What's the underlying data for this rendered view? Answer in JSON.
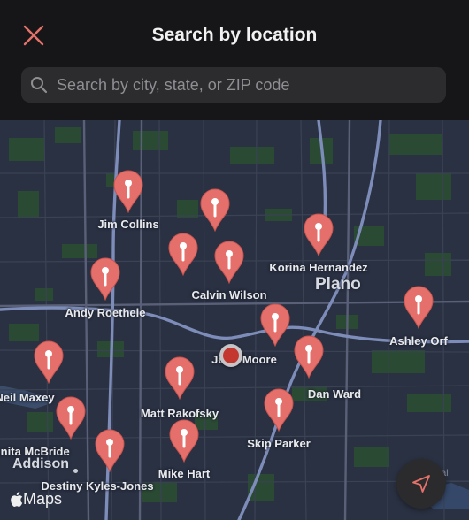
{
  "header": {
    "title": "Search by location",
    "close_icon": "close-icon"
  },
  "search": {
    "placeholder": "Search by city, state, or ZIP code",
    "value": "",
    "icon": "search-icon"
  },
  "map": {
    "cities": {
      "plano": "Plano",
      "addison": "Addison"
    },
    "pins": [
      {
        "id": "jim-collins",
        "label": "Jim Collins"
      },
      {
        "id": "unlabeled-1",
        "label": ""
      },
      {
        "id": "korina-hernandez",
        "label": "Korina Hernandez"
      },
      {
        "id": "unlabeled-2",
        "label": ""
      },
      {
        "id": "calvin-wilson",
        "label": "Calvin Wilson"
      },
      {
        "id": "andy-roethele",
        "label": "Andy Roethele"
      },
      {
        "id": "ashley-orf",
        "label": "Ashley Orf"
      },
      {
        "id": "john-moore",
        "label": "John Moore"
      },
      {
        "id": "dan-ward",
        "label": "Dan Ward"
      },
      {
        "id": "neil-maxey",
        "label": "Neil Maxey"
      },
      {
        "id": "matt-rakofsky",
        "label": "Matt Rakofsky"
      },
      {
        "id": "anita-mcbride",
        "label": "Anita McBride"
      },
      {
        "id": "skip-parker",
        "label": "Skip Parker"
      },
      {
        "id": "mike-hart",
        "label": "Mike Hart"
      },
      {
        "id": "destiny-kyles-jones",
        "label": "Destiny Kyles-Jones"
      }
    ],
    "attribution": "Maps",
    "legal": "Legal",
    "locate_icon": "location-arrow-icon"
  },
  "colors": {
    "pin": "#e56f6b",
    "user_location": "#c4372f",
    "map_background": "#2a3142"
  }
}
